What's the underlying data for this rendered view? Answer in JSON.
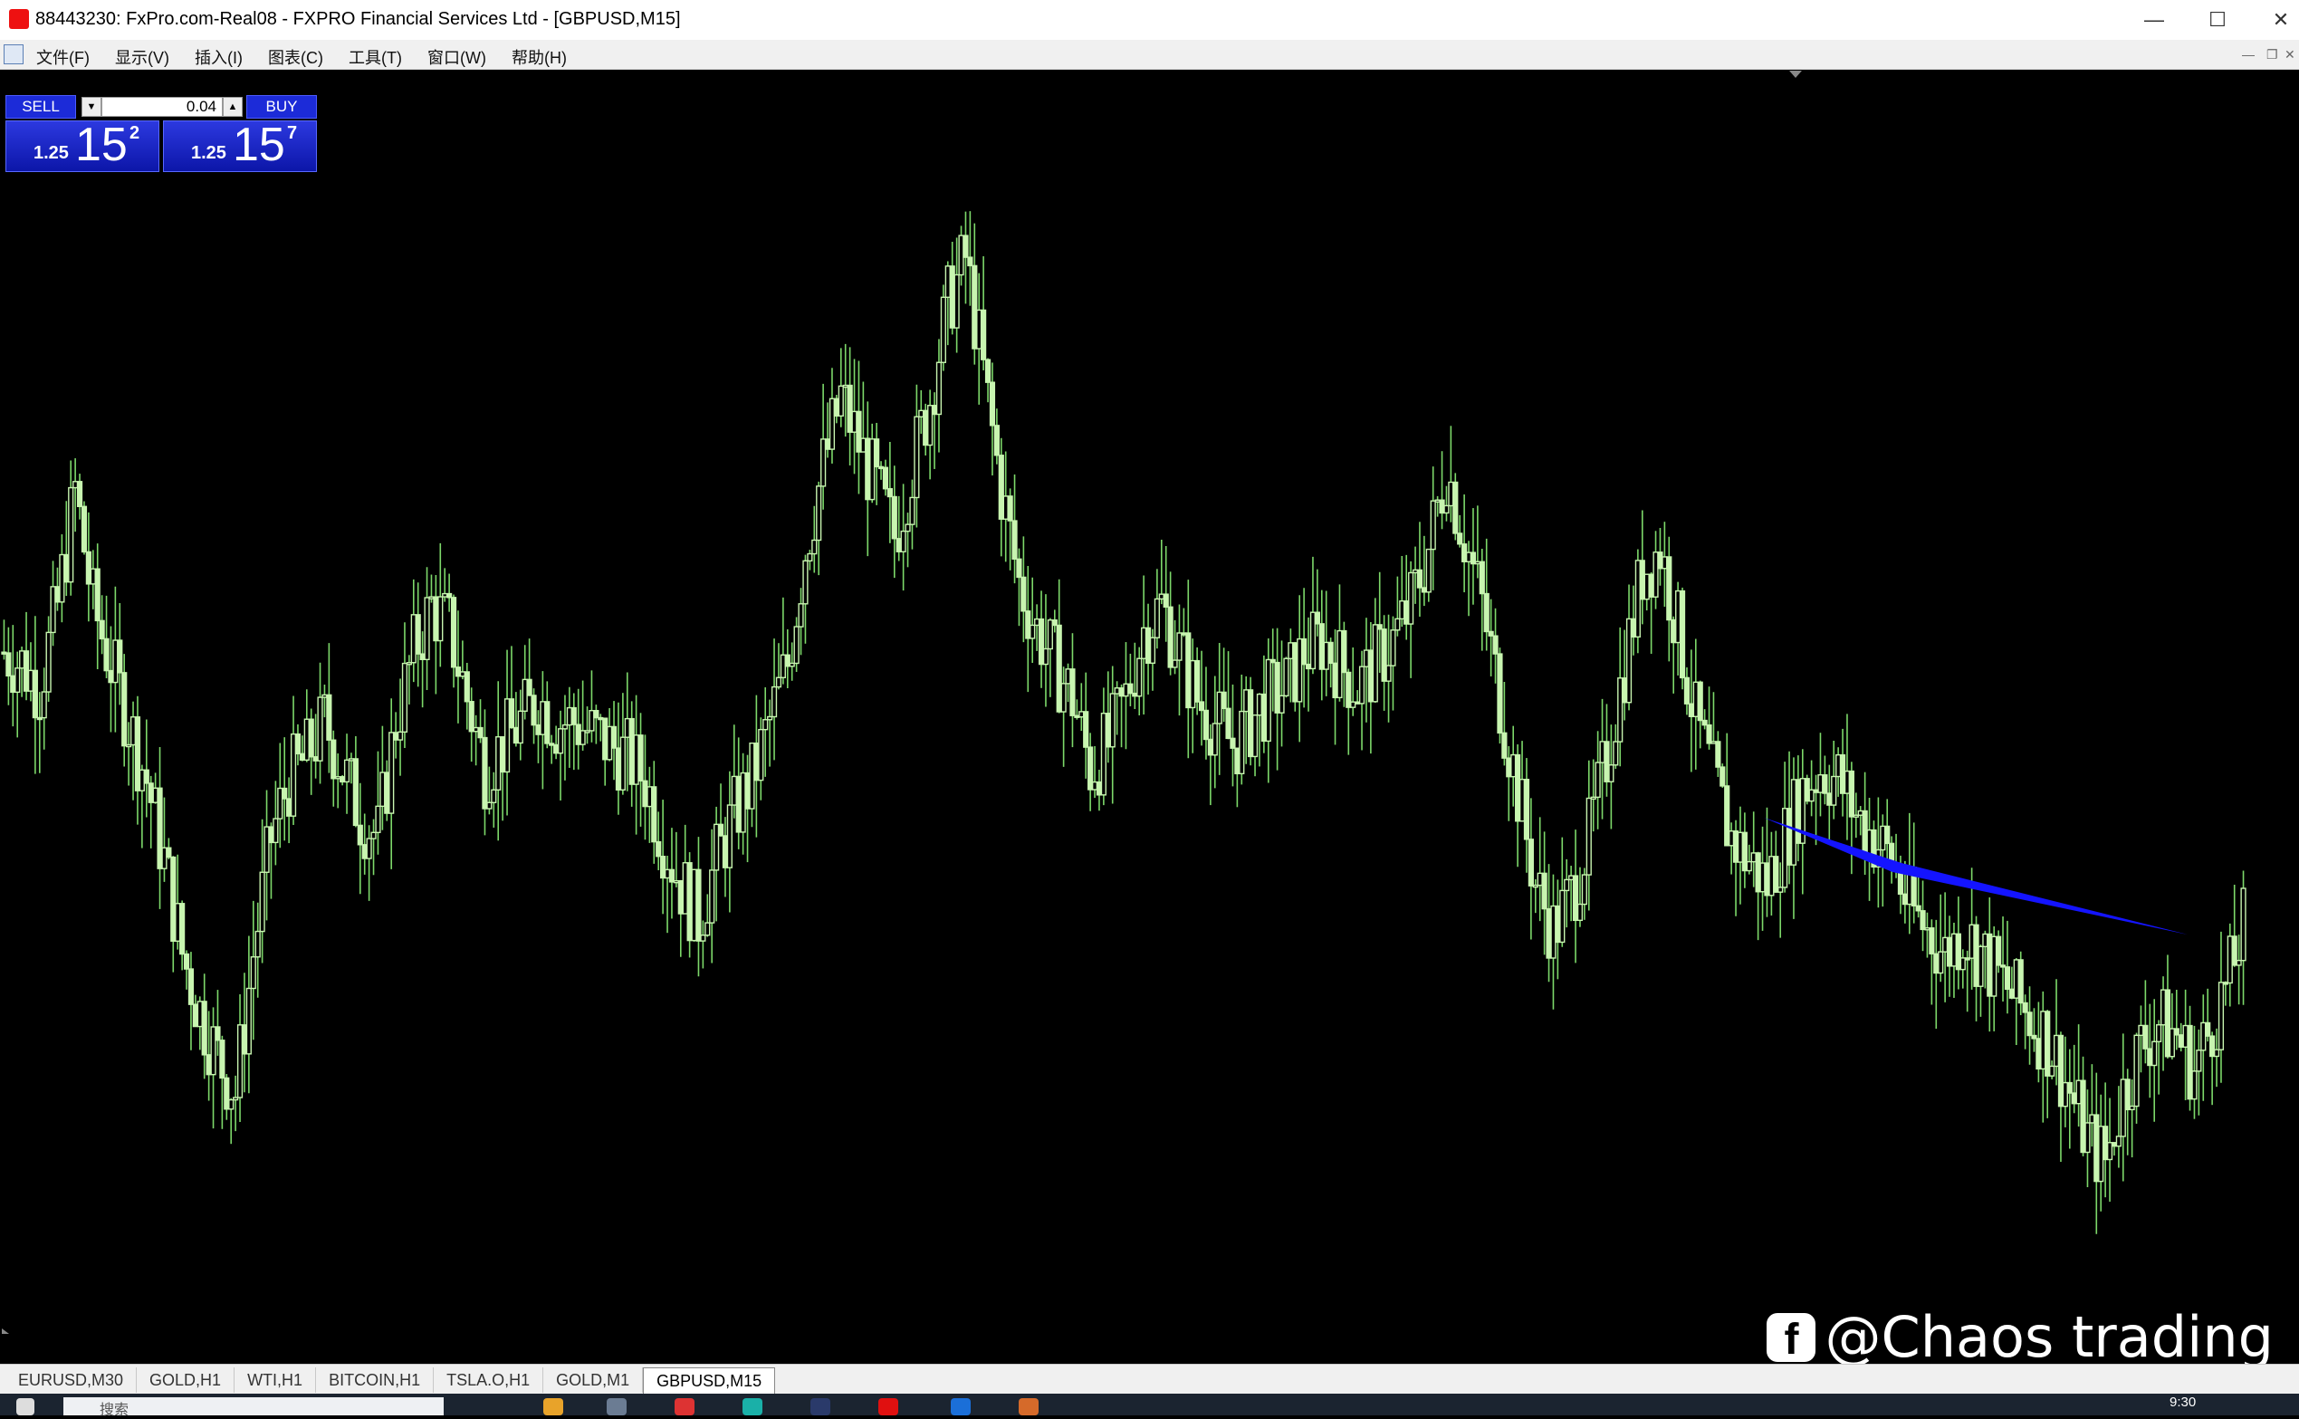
{
  "window": {
    "title": "88443230: FxPro.com-Real08 - FXPRO Financial Services Ltd - [GBPUSD,M15]",
    "minimize": "—",
    "maximize": "☐",
    "close": "✕"
  },
  "menu": {
    "items": [
      "文件(F)",
      "显示(V)",
      "插入(I)",
      "图表(C)",
      "工具(T)",
      "窗口(W)",
      "帮助(H)"
    ]
  },
  "trade_panel": {
    "sell_label": "SELL",
    "buy_label": "BUY",
    "lot": "0.04",
    "sell_price": {
      "prefix": "1.25",
      "big": "15",
      "sup": "2"
    },
    "buy_price": {
      "prefix": "1.25",
      "big": "15",
      "sup": "7"
    }
  },
  "watermark": {
    "text": "@Chaos trading",
    "icon": "facebook-icon"
  },
  "tabs": [
    "EURUSD,M30",
    "GOLD,H1",
    "WTI,H1",
    "BITCOIN,H1",
    "TSLA.O,H1",
    "GOLD,M1",
    "GBPUSD,M15"
  ],
  "active_tab": "GBPUSD,M15",
  "taskbar": {
    "search_placeholder": "搜索",
    "time": "9:30"
  },
  "colors": {
    "candle": "#c8f5b0",
    "wick": "#7dd86a",
    "arrow": "#1414ff",
    "background": "#000000"
  },
  "chart_data": {
    "type": "candlestick",
    "symbol": "GBPUSD",
    "timeframe": "M15",
    "series_shape": [
      0.56,
      0.55,
      0.53,
      0.6,
      0.7,
      0.6,
      0.55,
      0.5,
      0.45,
      0.38,
      0.3,
      0.25,
      0.21,
      0.18,
      0.3,
      0.4,
      0.45,
      0.47,
      0.5,
      0.46,
      0.42,
      0.4,
      0.5,
      0.56,
      0.6,
      0.58,
      0.52,
      0.46,
      0.48,
      0.5,
      0.52,
      0.5,
      0.5,
      0.49,
      0.48,
      0.47,
      0.45,
      0.4,
      0.36,
      0.33,
      0.38,
      0.42,
      0.45,
      0.5,
      0.55,
      0.65,
      0.72,
      0.78,
      0.74,
      0.7,
      0.66,
      0.72,
      0.78,
      0.86,
      0.9,
      0.8,
      0.7,
      0.62,
      0.58,
      0.55,
      0.52,
      0.46,
      0.48,
      0.52,
      0.58,
      0.6,
      0.56,
      0.52,
      0.5,
      0.48,
      0.5,
      0.52,
      0.53,
      0.56,
      0.57,
      0.55,
      0.53,
      0.55,
      0.57,
      0.6,
      0.65,
      0.72,
      0.66,
      0.6,
      0.52,
      0.44,
      0.36,
      0.32,
      0.35,
      0.4,
      0.47,
      0.55,
      0.63,
      0.65,
      0.58,
      0.5,
      0.45,
      0.4,
      0.38,
      0.36,
      0.4,
      0.44,
      0.46,
      0.45,
      0.42,
      0.4,
      0.38,
      0.34,
      0.32,
      0.3,
      0.32,
      0.3,
      0.28,
      0.26,
      0.24,
      0.22,
      0.18,
      0.14,
      0.12,
      0.18,
      0.22,
      0.24,
      0.23,
      0.2,
      0.24,
      0.28,
      0.34
    ]
  }
}
